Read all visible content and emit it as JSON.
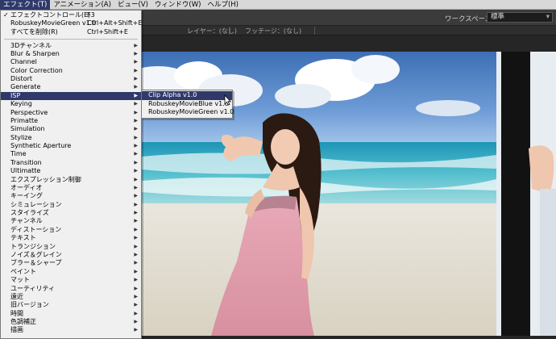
{
  "menubar": {
    "items": [
      {
        "label": "エフェクト(T)",
        "active": true
      },
      {
        "label": "アニメーション(A)",
        "active": false
      },
      {
        "label": "ビュー(V)",
        "active": false
      },
      {
        "label": "ウィンドウ(W)",
        "active": false
      },
      {
        "label": "ヘルプ(H)",
        "active": false
      }
    ]
  },
  "workspace": {
    "label": "ワークスペース：",
    "value": "標準"
  },
  "panel": {
    "layer_tab": "レイヤー：(なし)",
    "footage_tab": "フッテージ：(なし)"
  },
  "effect_menu": {
    "top_items": [
      {
        "label": "エフェクトコントロール(E)",
        "shortcut": "F3",
        "checked": true
      },
      {
        "label": "RobuskeyMovieGreen v1.0",
        "shortcut": "Ctrl+Alt+Shift+E",
        "checked": false
      },
      {
        "label": "すべてを削除(R)",
        "shortcut": "Ctrl+Shift+E",
        "checked": false
      }
    ],
    "categories": [
      "3Dチャンネル",
      "Blur & Sharpen",
      "Channel",
      "Color Correction",
      "Distort",
      "Generate",
      "ISP",
      "Keying",
      "Perspective",
      "Primatte",
      "Simulation",
      "Stylize",
      "Synthetic Aperture",
      "Time",
      "Transition",
      "Ultimatte",
      "エクスプレッション制御",
      "オーディオ",
      "キーイング",
      "シミュレーション",
      "スタイライズ",
      "チャンネル",
      "ディストーション",
      "テキスト",
      "トランジション",
      "ノイズ＆グレイン",
      "ブラー＆シャープ",
      "ペイント",
      "マット",
      "ユーティリティ",
      "遠近",
      "旧バージョン",
      "時間",
      "色調補正",
      "描画"
    ],
    "selected_category": "ISP"
  },
  "isp_submenu": {
    "items": [
      "Clip Alpha v1.0",
      "RobuskeyMovieBlue v1.0",
      "RobuskeyMovieGreen v1.0"
    ],
    "selected": "Clip Alpha v1.0"
  },
  "colors": {
    "menu_highlight": "#2f3a6b",
    "menu_bg": "#f0f0f0",
    "chrome_dark": "#3b3b3b"
  }
}
